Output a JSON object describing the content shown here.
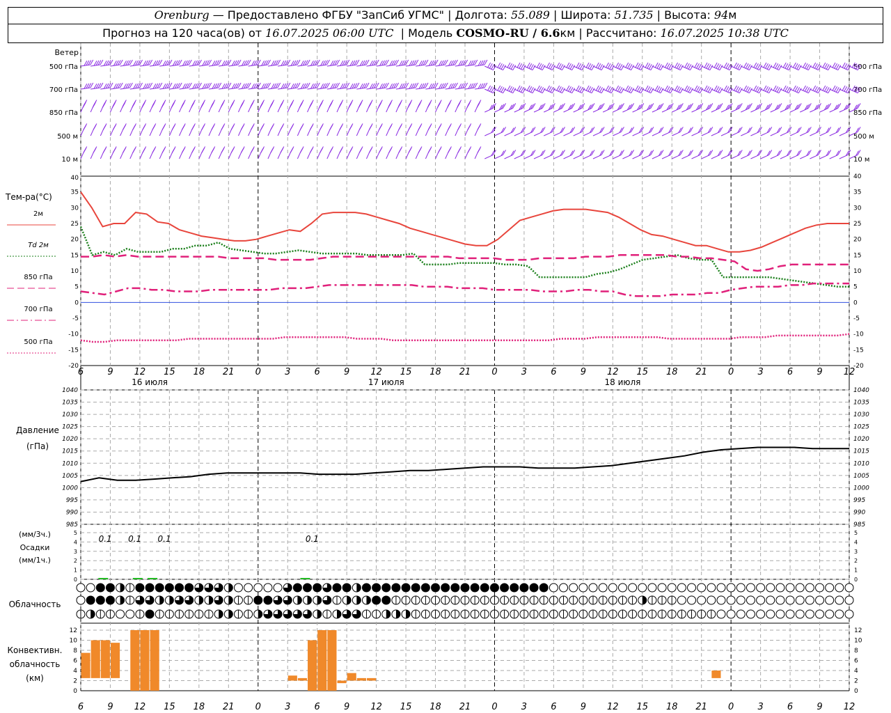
{
  "header": {
    "station": "Orenburg",
    "provider": "— Предоставлено ФГБУ \"ЗапСиб УГМС\" |",
    "lon_label": "Долгота:",
    "lon": "55.089",
    "lat_label": "| Широта:",
    "lat": "51.735",
    "alt_label": "| Высота:",
    "alt": "94",
    "alt_unit": "м",
    "forecast_label": "Прогноз на 120 часа(ов) от",
    "start": "16.07.2025 06:00 UTC",
    "model_label": "| Модель",
    "model": "COSMO-RU / 6.6",
    "model_unit": "км",
    "calc_label": "| Рассчитано:",
    "calc": "16.07.2025 10:38 UTC"
  },
  "time_axis": {
    "hour_labels": [
      "6",
      "9",
      "12",
      "15",
      "18",
      "21",
      "0",
      "3",
      "6",
      "9",
      "12",
      "15",
      "18",
      "21",
      "0",
      "3",
      "6",
      "9",
      "12",
      "15",
      "18",
      "21",
      "0",
      "3",
      "6",
      "9",
      "12"
    ],
    "day_labels": [
      "16 июля",
      "17 июля",
      "18 июля"
    ]
  },
  "wind_panel": {
    "title": "Ветер",
    "levels": [
      "500 гПа",
      "700 гПа",
      "850 гПа",
      "500 м",
      "10   м"
    ]
  },
  "colors": {
    "t2m": "#e8453c",
    "td2m": "#1a7f1a",
    "t850": "#e0207a",
    "t700": "#e0207a",
    "t500": "#e0207a",
    "wind": "#8a2be2",
    "zero_line": "#3050e0",
    "conv": "#f0892a",
    "precip": "#22bb22"
  },
  "chart_data": [
    {
      "type": "line",
      "name": "temperature",
      "ylabel": "Тем-ра(°С)",
      "ylim": [
        -20,
        40
      ],
      "yticks": [
        -20,
        -15,
        -10,
        -5,
        0,
        5,
        10,
        15,
        20,
        25,
        30,
        35,
        40
      ],
      "x_hours": [
        0,
        1,
        2,
        3,
        4,
        5,
        6,
        7,
        8,
        9,
        10,
        11,
        12,
        13,
        14,
        15,
        16,
        17,
        18,
        19,
        20,
        21,
        22,
        23,
        24,
        25,
        26,
        27,
        28,
        29,
        30,
        31,
        32,
        33,
        34,
        35,
        36,
        37,
        38,
        39,
        40,
        41,
        42,
        43,
        44,
        45,
        46,
        47,
        48,
        49,
        50,
        51,
        52,
        53,
        54,
        55,
        56,
        57,
        58,
        59,
        60,
        61,
        62,
        63,
        64,
        65,
        66,
        67,
        68,
        69,
        70,
        71,
        72,
        73,
        74,
        75,
        76,
        77,
        78
      ],
      "legend": [
        {
          "label": "2м",
          "style": "solid",
          "color_key": "t2m"
        },
        {
          "label": "Td  2м",
          "style": "dotted",
          "color_key": "td2m"
        },
        {
          "label": "850 гПа",
          "style": "dashed",
          "color_key": "t850"
        },
        {
          "label": "700 гПа",
          "style": "dashdot",
          "color_key": "t700"
        },
        {
          "label": "500 гПа",
          "style": "dotted",
          "color_key": "t500"
        }
      ],
      "series": [
        {
          "key": "t2m",
          "values": [
            35,
            30,
            24,
            25,
            25,
            28.5,
            28,
            25.5,
            25,
            23,
            22,
            21,
            20.5,
            20,
            19.5,
            19.5,
            20,
            21,
            22,
            23,
            22.5,
            25,
            28,
            28.5,
            28.5,
            28.5,
            28,
            27,
            26,
            25,
            23.5,
            22.5,
            21.5,
            20.5,
            19.5,
            18.5,
            18,
            18,
            20,
            23,
            26,
            27,
            28,
            29,
            29.5,
            29.5,
            29.5,
            29,
            28.5,
            27,
            25,
            23,
            21.5,
            21,
            20,
            19,
            18,
            18,
            17,
            16,
            16,
            16.5,
            17.5,
            19,
            20.5,
            22,
            23.5,
            24.5,
            25,
            25,
            25
          ]
        },
        {
          "key": "td2m",
          "values": [
            24,
            15,
            16,
            15,
            17,
            16,
            16,
            16,
            17,
            17,
            18,
            18,
            19,
            17,
            16.5,
            16,
            15.5,
            15.5,
            16,
            16.5,
            16,
            15.5,
            15.5,
            15.5,
            15.5,
            15,
            15,
            15,
            15,
            15.5,
            12,
            12,
            12,
            12.5,
            12.5,
            12.5,
            12.5,
            12,
            12,
            11.5,
            8,
            8,
            8,
            8,
            8,
            9,
            9.5,
            10.5,
            12,
            13.5,
            14,
            14.5,
            15,
            14,
            13.5,
            13.5,
            8,
            8,
            8,
            8,
            8,
            7.5,
            7,
            6.5,
            6,
            5.5,
            5,
            5
          ]
        },
        {
          "key": "t850",
          "values": [
            14.5,
            14.5,
            15,
            14.5,
            15,
            14.5,
            14.5,
            14.5,
            14.5,
            14.5,
            14.5,
            14.5,
            14.5,
            14,
            14,
            14,
            14,
            13.5,
            13.5,
            13.5,
            13.5,
            14,
            14.5,
            14.5,
            14.5,
            14.5,
            14.5,
            14.5,
            14.5,
            14.5,
            14.5,
            14.5,
            14.5,
            14,
            14,
            14,
            14,
            13.5,
            13.5,
            13.5,
            14,
            14,
            14,
            14,
            14.5,
            14.5,
            14.5,
            15,
            15,
            15,
            15,
            15,
            14.5,
            14.5,
            14,
            14,
            13.5,
            13,
            10.5,
            10,
            10.5,
            11.5,
            12,
            12,
            12,
            12,
            12,
            12
          ]
        },
        {
          "key": "t700",
          "values": [
            3.5,
            3,
            2.5,
            3.5,
            4.5,
            4.5,
            4,
            4,
            3.5,
            3.5,
            3.5,
            4,
            4,
            4,
            4,
            4,
            4,
            4.5,
            4.5,
            4.5,
            5,
            5.5,
            5.5,
            5.5,
            5.5,
            5.5,
            5.5,
            5.5,
            5.5,
            5,
            5,
            5,
            4.5,
            4.5,
            4.5,
            4,
            4,
            4,
            4,
            3.5,
            3.5,
            3.5,
            4,
            4,
            3.5,
            3.5,
            2.5,
            2,
            2,
            2,
            2.5,
            2.5,
            2.5,
            3,
            3,
            4,
            4.5,
            5,
            5,
            5,
            5.5,
            5.5,
            6,
            6,
            6,
            6
          ]
        },
        {
          "key": "t500",
          "values": [
            -12,
            -12.5,
            -12.5,
            -12,
            -12,
            -12,
            -12,
            -12,
            -12,
            -11.5,
            -11.5,
            -11.5,
            -11.5,
            -11.5,
            -11.5,
            -11.5,
            -11.5,
            -11,
            -11,
            -11,
            -11,
            -11,
            -11,
            -11.5,
            -11.5,
            -11.5,
            -12,
            -12,
            -12,
            -12,
            -12,
            -12,
            -12,
            -12,
            -12,
            -12,
            -12,
            -12,
            -12,
            -12,
            -11.5,
            -11.5,
            -11.5,
            -11,
            -11,
            -11,
            -11,
            -11,
            -11,
            -11.5,
            -11.5,
            -11.5,
            -11.5,
            -11.5,
            -11.5,
            -11,
            -11,
            -11,
            -10.5,
            -10.5,
            -10.5,
            -10.5,
            -10.5,
            -10.5,
            -10
          ]
        }
      ]
    },
    {
      "type": "line",
      "name": "pressure",
      "ylabel": "Давление",
      "ylabel2": "(гПа)",
      "ylim": [
        985,
        1040
      ],
      "yticks": [
        985,
        990,
        995,
        1000,
        1005,
        1010,
        1015,
        1020,
        1025,
        1030,
        1035,
        1040
      ],
      "series": [
        {
          "key": "pressure",
          "values": [
            1002.5,
            1004,
            1003,
            1003,
            1003.5,
            1004,
            1004.5,
            1005.5,
            1006,
            1006,
            1006,
            1006,
            1006,
            1005.5,
            1005.5,
            1005.5,
            1006,
            1006.5,
            1007,
            1007,
            1007.5,
            1008,
            1008.5,
            1008.5,
            1008.5,
            1008,
            1008,
            1008,
            1008.5,
            1009,
            1010,
            1011,
            1012,
            1013,
            1014.5,
            1015.5,
            1016,
            1016.5,
            1016.5,
            1016.5,
            1016,
            1016,
            1016
          ]
        }
      ]
    },
    {
      "type": "bar",
      "name": "precipitation",
      "ylabel": "(мм/3ч.)",
      "ylabel2": "Осадки",
      "ylabel3": "(мм/1ч.)",
      "ylim": [
        0,
        5
      ],
      "yticks": [
        0,
        1,
        2,
        3,
        4,
        5
      ],
      "annotations": [
        {
          "hour": 1,
          "text": "0.1"
        },
        {
          "hour": 4,
          "text": "0.1"
        },
        {
          "hour": 7,
          "text": "0.1"
        },
        {
          "hour": 22,
          "text": "0.1"
        }
      ],
      "bars": [
        {
          "hour": 2,
          "value": 0.1
        },
        {
          "hour": 5.5,
          "value": 0.1
        },
        {
          "hour": 7,
          "value": 0.1
        },
        {
          "hour": 22.5,
          "value": 0.1
        }
      ]
    },
    {
      "type": "bar",
      "name": "convective_cloud",
      "ylabel": "Конвективн.",
      "ylabel2": "облачность",
      "ylabel3": "(км)",
      "ylim": [
        0,
        12
      ],
      "yticks": [
        0,
        2,
        4,
        6,
        8,
        10,
        12
      ],
      "bars": [
        {
          "hour": 0.5,
          "base": 2.5,
          "top": 7.5
        },
        {
          "hour": 1.5,
          "base": 2.5,
          "top": 10
        },
        {
          "hour": 2.5,
          "base": 2.5,
          "top": 10
        },
        {
          "hour": 3.5,
          "base": 2.5,
          "top": 9.5
        },
        {
          "hour": 5.5,
          "base": 0,
          "top": 12
        },
        {
          "hour": 6.5,
          "base": 0,
          "top": 12
        },
        {
          "hour": 7.5,
          "base": 0,
          "top": 12
        },
        {
          "hour": 21.5,
          "base": 2,
          "top": 3
        },
        {
          "hour": 22.5,
          "base": 2,
          "top": 2.5
        },
        {
          "hour": 23.5,
          "base": 0,
          "top": 10
        },
        {
          "hour": 24.5,
          "base": 0,
          "top": 12
        },
        {
          "hour": 25.5,
          "base": 0,
          "top": 12
        },
        {
          "hour": 26.5,
          "base": 1.5,
          "top": 2
        },
        {
          "hour": 27.5,
          "base": 2,
          "top": 3.5
        },
        {
          "hour": 28.5,
          "base": 2,
          "top": 2.5
        },
        {
          "hour": 29.5,
          "base": 2,
          "top": 2.5
        },
        {
          "hour": 64.5,
          "base": 2.5,
          "top": 4
        }
      ]
    }
  ],
  "cloud_panel": {
    "title": "Облачность",
    "rows": [
      [
        0,
        0,
        4,
        4,
        2,
        1,
        4,
        4,
        4,
        4,
        4,
        4,
        3,
        3,
        3,
        2,
        0,
        0,
        0,
        0,
        0,
        3,
        4,
        4,
        4,
        3,
        4,
        4,
        2,
        4,
        4,
        4,
        4,
        4,
        4,
        4,
        4,
        4,
        4,
        4,
        4,
        4,
        4,
        4,
        4,
        4,
        4,
        4,
        0,
        0,
        0,
        0,
        0,
        0,
        0,
        0,
        0,
        0,
        0,
        0,
        0,
        0,
        0,
        0,
        0,
        0,
        0,
        0,
        0,
        0,
        0,
        0,
        0,
        0,
        0,
        0,
        0,
        0,
        0
      ],
      [
        0,
        4,
        4,
        4,
        2,
        1,
        3,
        3,
        2,
        2,
        3,
        3,
        2,
        2,
        3,
        2,
        1,
        1,
        4,
        4,
        3,
        3,
        2,
        2,
        2,
        3,
        1,
        2,
        2,
        2,
        4,
        4,
        1,
        1,
        1,
        1,
        1,
        1,
        1,
        1,
        1,
        1,
        1,
        1,
        1,
        1,
        1,
        1,
        1,
        1,
        1,
        1,
        1,
        1,
        1,
        1,
        1,
        2,
        1,
        1,
        1,
        0,
        0,
        0,
        0,
        0,
        0,
        0,
        0,
        0,
        0,
        0,
        0,
        0,
        0,
        0,
        0,
        0,
        0
      ],
      [
        1,
        2,
        1,
        1,
        0,
        0,
        1,
        4,
        1,
        1,
        1,
        1,
        1,
        1,
        2,
        2,
        1,
        1,
        2,
        3,
        3,
        3,
        3,
        3,
        2,
        1,
        2,
        3,
        3,
        1,
        1,
        2,
        2,
        2,
        1,
        1,
        1,
        1,
        1,
        1,
        1,
        1,
        1,
        1,
        1,
        1,
        1,
        1,
        1,
        1,
        1,
        1,
        1,
        1,
        1,
        1,
        1,
        1,
        1,
        1,
        1,
        1,
        1,
        1,
        1,
        0,
        0,
        0,
        0,
        0,
        0,
        0,
        0,
        0,
        0,
        0,
        0,
        0,
        0
      ]
    ]
  }
}
